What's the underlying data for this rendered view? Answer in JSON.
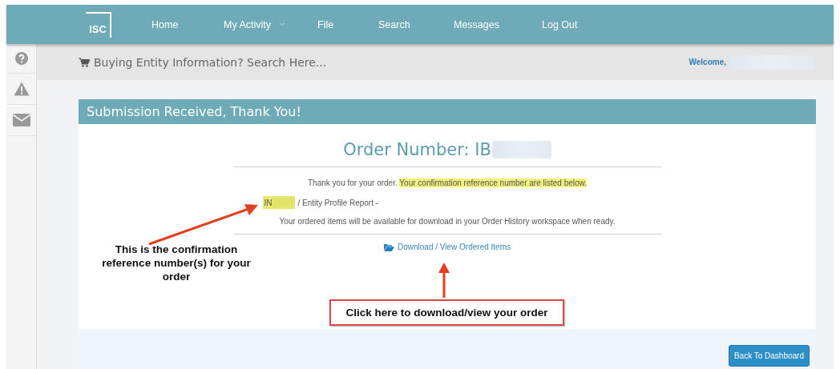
{
  "nav": {
    "logo": "ISC",
    "items": [
      {
        "label": "Home",
        "dropdown": false
      },
      {
        "label": "My Activity",
        "dropdown": true
      },
      {
        "label": "File",
        "dropdown": false
      },
      {
        "label": "Search",
        "dropdown": false
      },
      {
        "label": "Messages",
        "dropdown": false
      },
      {
        "label": "Log Out",
        "dropdown": false
      }
    ]
  },
  "search_bar": {
    "text": "Buying Entity Information? Search Here...",
    "welcome": "Welcome,"
  },
  "panel": {
    "title": "Submission Received, Thank You!",
    "order_number": "Order Number: IB",
    "message": [
      {
        "text": "Thank you for your order.",
        "highlighted": false
      },
      {
        "text": "Your confirmation reference number are listed below.",
        "highlighted": true
      }
    ],
    "reference": {
      "code": "IN",
      "description": "/ Entity Profile Report -"
    },
    "availability": "Your ordered items will be available for download in your Order History workspace when ready.",
    "download_link": "Download / View Ordered Items",
    "button": "Back To Dashboard"
  },
  "annotations": [
    {
      "kind": "plain",
      "text": "This is the confirmation reference number(s) for your order"
    },
    {
      "kind": "boxed",
      "text": "Click here to download/view your order"
    }
  ]
}
